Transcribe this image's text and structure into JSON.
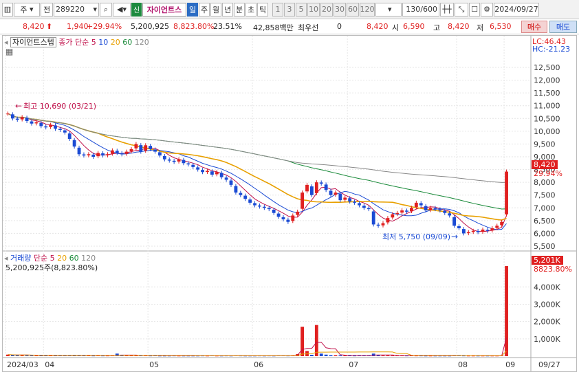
{
  "toolbar": {
    "market_type": "주",
    "period_label": "전",
    "stock_code": "289220",
    "badge": "신",
    "stock_name": "자이언트스",
    "periods": [
      "일",
      "주",
      "월",
      "년",
      "분",
      "초",
      "틱"
    ],
    "selected_period": "일",
    "intervals": [
      "1",
      "3",
      "5",
      "10",
      "20",
      "30",
      "60",
      "120"
    ],
    "count": "130/600",
    "date": "2024/09/27"
  },
  "quote": {
    "price": "8,420",
    "change": "1,940",
    "change_pct": "+29.94%",
    "volume": "5,200,925",
    "volume_pct": "8,823.80%",
    "turnover_pct": "23.51%",
    "amount": "42,858백만",
    "best_bid_label": "최우선",
    "best_bid_value": "0",
    "last": "8,420",
    "open_label": "시",
    "open": "6,590",
    "high_label": "고",
    "high": "8,420",
    "low_label": "저",
    "low": "6,530",
    "buy_label": "매수",
    "sell_label": "매도"
  },
  "price_panel": {
    "stock_tag": "자이언트스텝",
    "ma_label": "종가 단순",
    "ma_periods": [
      "5",
      "10",
      "20",
      "60",
      "120"
    ],
    "lc": "LC:46.43",
    "hc": "HC:-21.23",
    "high_annotation": "최고 10,690 (03/21)",
    "low_annotation": "최저 5,750 (09/09)",
    "current_price_tag": "8,420",
    "current_change_tag": "29.94%",
    "y_ticks": [
      "12,500",
      "12,000",
      "11,500",
      "11,000",
      "10,500",
      "10,000",
      "9,500",
      "9,000",
      "8,500",
      "8,000",
      "7,500",
      "7,000",
      "6,500",
      "6,000",
      "5,500"
    ]
  },
  "volume_panel": {
    "label": "거래량",
    "ma_label": "단순",
    "ma_periods": [
      "5",
      "20",
      "60",
      "120"
    ],
    "summary": "5,200,925주(8,823.80%)",
    "current_tag": "5,201K",
    "current_pct_tag": "8823.80%",
    "y_ticks": [
      "4,000K",
      "3,000K",
      "2,000K",
      "1,000K"
    ]
  },
  "x_axis": {
    "labels": [
      "2024/03",
      "04",
      "05",
      "06",
      "07",
      "08",
      "09"
    ],
    "end_label": "09/27"
  },
  "chart_data": {
    "type": "candlestick",
    "price_range": [
      5500,
      12500
    ],
    "volume_range": [
      0,
      5400
    ],
    "volume_unit": "K",
    "months": [
      "2024/03",
      "04",
      "05",
      "06",
      "07",
      "08",
      "09"
    ],
    "close_series_daily": [
      10690,
      10500,
      10450,
      10550,
      10400,
      10300,
      10350,
      10200,
      10150,
      10250,
      10100,
      10050,
      9950,
      9700,
      9400,
      9100,
      9050,
      9100,
      9000,
      9150,
      9050,
      9100,
      9250,
      9150,
      9100,
      9200,
      9300,
      9500,
      9200,
      9450,
      9300,
      9200,
      9050,
      8900,
      8850,
      8800,
      8900,
      8750,
      8700,
      8600,
      8500,
      8400,
      8450,
      8300,
      8400,
      8200,
      8100,
      7900,
      7600,
      7500,
      7350,
      7200,
      7100,
      7050,
      7000,
      6950,
      6800,
      6650,
      6550,
      6450,
      6700,
      6850,
      7600,
      7900,
      7500,
      8000,
      7950,
      7700,
      7500,
      7600,
      7300,
      7400,
      7250,
      7200,
      7100,
      7000,
      6950,
      6350,
      6300,
      6400,
      6600,
      6750,
      6800,
      6900,
      6850,
      7000,
      7200,
      7100,
      6900,
      7000,
      6950,
      6900,
      6800,
      6700,
      6300,
      6200,
      6000,
      6050,
      6100,
      6050,
      6150,
      6100,
      6200,
      6300,
      6450,
      8420
    ],
    "price_markers": [
      {
        "label": "최고",
        "value": 10690,
        "date": "03/21"
      },
      {
        "label": "최저",
        "value": 5750,
        "date": "09/09"
      },
      {
        "label": "현재가",
        "value": 8420
      }
    ],
    "volume_series_K": [
      90,
      70,
      60,
      60,
      50,
      50,
      45,
      40,
      45,
      40,
      40,
      45,
      40,
      60,
      70,
      50,
      40,
      40,
      35,
      40,
      35,
      35,
      40,
      150,
      50,
      40,
      40,
      45,
      40,
      40,
      35,
      40,
      30,
      30,
      30,
      35,
      30,
      30,
      30,
      30,
      30,
      35,
      30,
      40,
      30,
      30,
      35,
      30,
      40,
      35,
      30,
      30,
      30,
      35,
      30,
      35,
      30,
      40,
      40,
      35,
      60,
      120,
      1700,
      300,
      80,
      1800,
      150,
      90,
      60,
      60,
      50,
      45,
      40,
      35,
      40,
      50,
      40,
      150,
      60,
      40,
      45,
      40,
      40,
      40,
      35,
      40,
      35,
      35,
      30,
      30,
      30,
      30,
      30,
      30,
      40,
      60,
      35,
      30,
      30,
      30,
      30,
      30,
      30,
      30,
      40,
      5201
    ]
  }
}
